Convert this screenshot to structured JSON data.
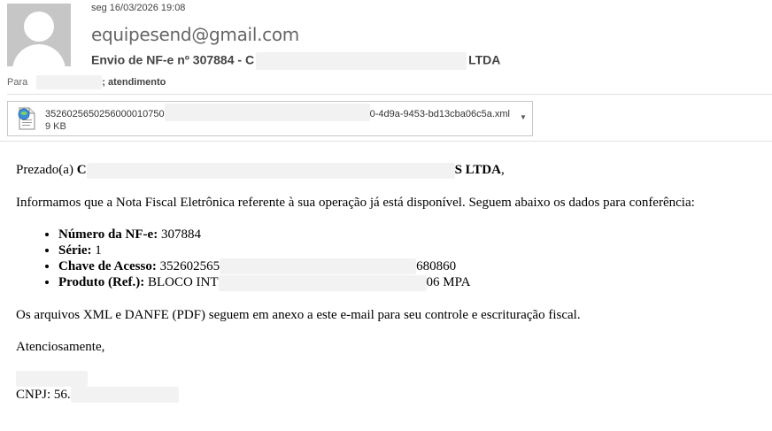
{
  "header": {
    "date": "seg 16/03/2026 19:08",
    "from": "equipesend@gmail.com",
    "subject_start": "Envio de NF-e nº 307884 - ",
    "subject_visible_prefix": "C",
    "subject_end": "LTDA"
  },
  "recipients": {
    "label": "Para",
    "tail": "; atendimento"
  },
  "attachment": {
    "name_start": "3526025650256000010750",
    "name_end": "0-4d9a-9453-bd13cba06c5a.xml",
    "size": "9 KB",
    "icon": "xml-file-icon",
    "dropdown_icon": "chevron-down-icon"
  },
  "email_body": {
    "greeting_start": "Prezado(a) ",
    "greeting_name_start": "C",
    "greeting_name_end": "S LTDA",
    "greeting_comma": ",",
    "intro": "Informamos que a Nota Fiscal Eletrônica referente à sua operação já está disponível. Seguem abaixo os dados para conferência:",
    "items": [
      {
        "label": "Número da NF-e:",
        "value": " 307884"
      },
      {
        "label": "Série:",
        "value": " 1"
      },
      {
        "label": "Chave de Acesso:",
        "value_start": " 352602565",
        "value_end": "680860"
      },
      {
        "label": "Produto (Ref.):",
        "value_start": " BLOCO INT",
        "value_end": "06 MPA"
      }
    ],
    "attachments_note": "Os arquivos XML e DANFE (PDF) seguem em anexo a este e-mail para seu controle e escrituração fiscal.",
    "closing": "Atenciosamente,",
    "cnpj_start": "CNPJ: 56."
  },
  "colors": {
    "avatar_bg": "#c6c6c6",
    "redaction": "#f2f2f2",
    "divider": "#e1e1e1"
  }
}
